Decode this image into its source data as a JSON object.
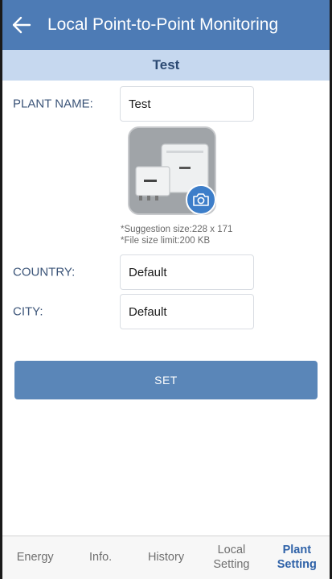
{
  "header": {
    "title": "Local Point-to-Point Monitoring"
  },
  "subheader": {
    "title": "Test"
  },
  "form": {
    "plant_name": {
      "label": "PLANT NAME:",
      "value": "Test"
    },
    "photo": {
      "hint_size": "*Suggestion size:228 x 171",
      "hint_limit": "*File size limit:200 KB"
    },
    "country": {
      "label": "COUNTRY:",
      "value": "Default"
    },
    "city": {
      "label": "CITY:",
      "value": "Default"
    }
  },
  "set_button": {
    "label": "SET"
  },
  "tabs": [
    {
      "label": "Energy",
      "active": false
    },
    {
      "label": "Info.",
      "active": false
    },
    {
      "label": "History",
      "active": false
    },
    {
      "label": "Local\nSetting",
      "active": false
    },
    {
      "label": "Plant\nSetting",
      "active": true
    }
  ],
  "colors": {
    "accent": "#4d7bb5",
    "subheader_bg": "#c6d8ef",
    "active_tab": "#2f62a8",
    "camera": "#3d7ec9"
  }
}
